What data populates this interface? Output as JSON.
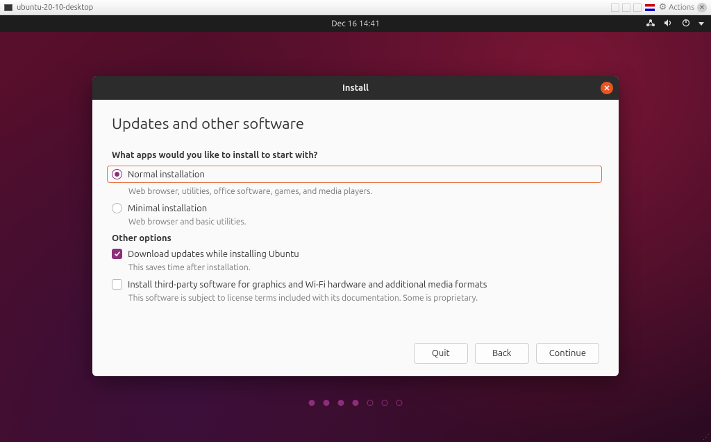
{
  "vm": {
    "tab_name": "ubuntu-20-10-desktop",
    "actions_label": "Actions"
  },
  "topbar": {
    "datetime": "Dec 16  14:41"
  },
  "dialog": {
    "title": "Install",
    "heading": "Updates and other software",
    "question1": "What apps would you like to install to start with?",
    "options": {
      "normal": {
        "label": "Normal installation",
        "desc": "Web browser, utilities, office software, games, and media players.",
        "selected": true
      },
      "minimal": {
        "label": "Minimal installation",
        "desc": "Web browser and basic utilities.",
        "selected": false
      }
    },
    "other_heading": "Other options",
    "checks": {
      "download_updates": {
        "label": "Download updates while installing Ubuntu",
        "desc": "This saves time after installation.",
        "checked": true
      },
      "third_party": {
        "label": "Install third-party software for graphics and Wi-Fi hardware and additional media formats",
        "desc": "This software is subject to license terms included with its documentation. Some is proprietary.",
        "checked": false
      }
    },
    "buttons": {
      "quit": "Quit",
      "back": "Back",
      "continue": "Continue"
    },
    "progress": {
      "total": 7,
      "current": 4
    }
  }
}
